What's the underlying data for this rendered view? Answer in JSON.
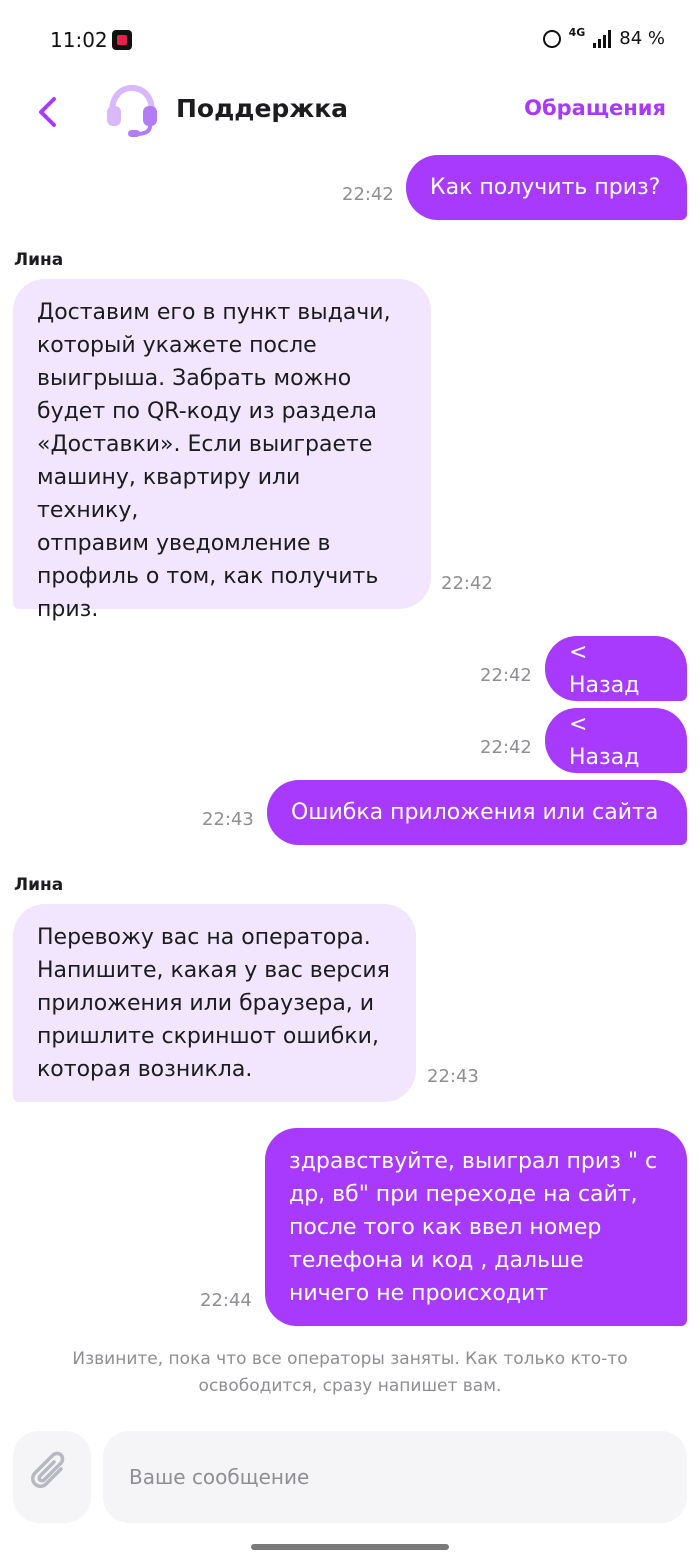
{
  "status_bar": {
    "time": "11:02",
    "network": "4G",
    "battery": "84 %"
  },
  "header": {
    "title": "Поддержка",
    "requests_label": "Обращения"
  },
  "messages": [
    {
      "direction": "outgoing",
      "text": "Как получить приз?",
      "time": "22:42"
    },
    {
      "direction": "incoming",
      "sender": "Лина",
      "lines": [
        "Доставим его в пункт выдачи,",
        "который укажете после",
        "выигрыша. Забрать можно",
        "будет по QR-коду из раздела",
        "«Доставки». Если выиграете",
        "машину, квартиру или технику,",
        "отправим уведомление в",
        "профиль о том, как получить",
        "приз."
      ],
      "time": "22:42"
    },
    {
      "direction": "outgoing",
      "text": "< Назад",
      "time": "22:42"
    },
    {
      "direction": "outgoing",
      "text": "< Назад",
      "time": "22:42"
    },
    {
      "direction": "outgoing",
      "text": "Ошибка приложения или сайта",
      "time": "22:43"
    },
    {
      "direction": "incoming",
      "sender": "Лина",
      "lines": [
        "Перевожу вас на оператора.",
        "Напишите, какая у вас версия",
        "приложения или браузера, и",
        "пришлите скриншот ошибки,",
        "которая возникла."
      ],
      "time": "22:43"
    },
    {
      "direction": "outgoing",
      "lines": [
        "здравствуйте, выиграл приз \" с",
        "др, вб\" при переходе на сайт,",
        "после того как ввел номер",
        "телефона и код , дальше",
        "ничего не происходит"
      ],
      "time": "22:44"
    }
  ],
  "system_note": {
    "line1": "Извините, пока что все операторы заняты. Как только кто-то",
    "line2": "освободится, сразу напишет вам."
  },
  "composer": {
    "placeholder": "Ваше сообщение"
  },
  "colors": {
    "accent": "#a73afd",
    "incoming_bubble": "#f1e6fe",
    "avatar_light": "#d9b8fb",
    "avatar_dark": "#b27cf4"
  },
  "icons": {
    "back": "chevron-left-icon",
    "avatar": "headset-icon",
    "attach": "paperclip-icon",
    "alarm": "alarm-clock-icon",
    "signal": "signal-icon"
  }
}
